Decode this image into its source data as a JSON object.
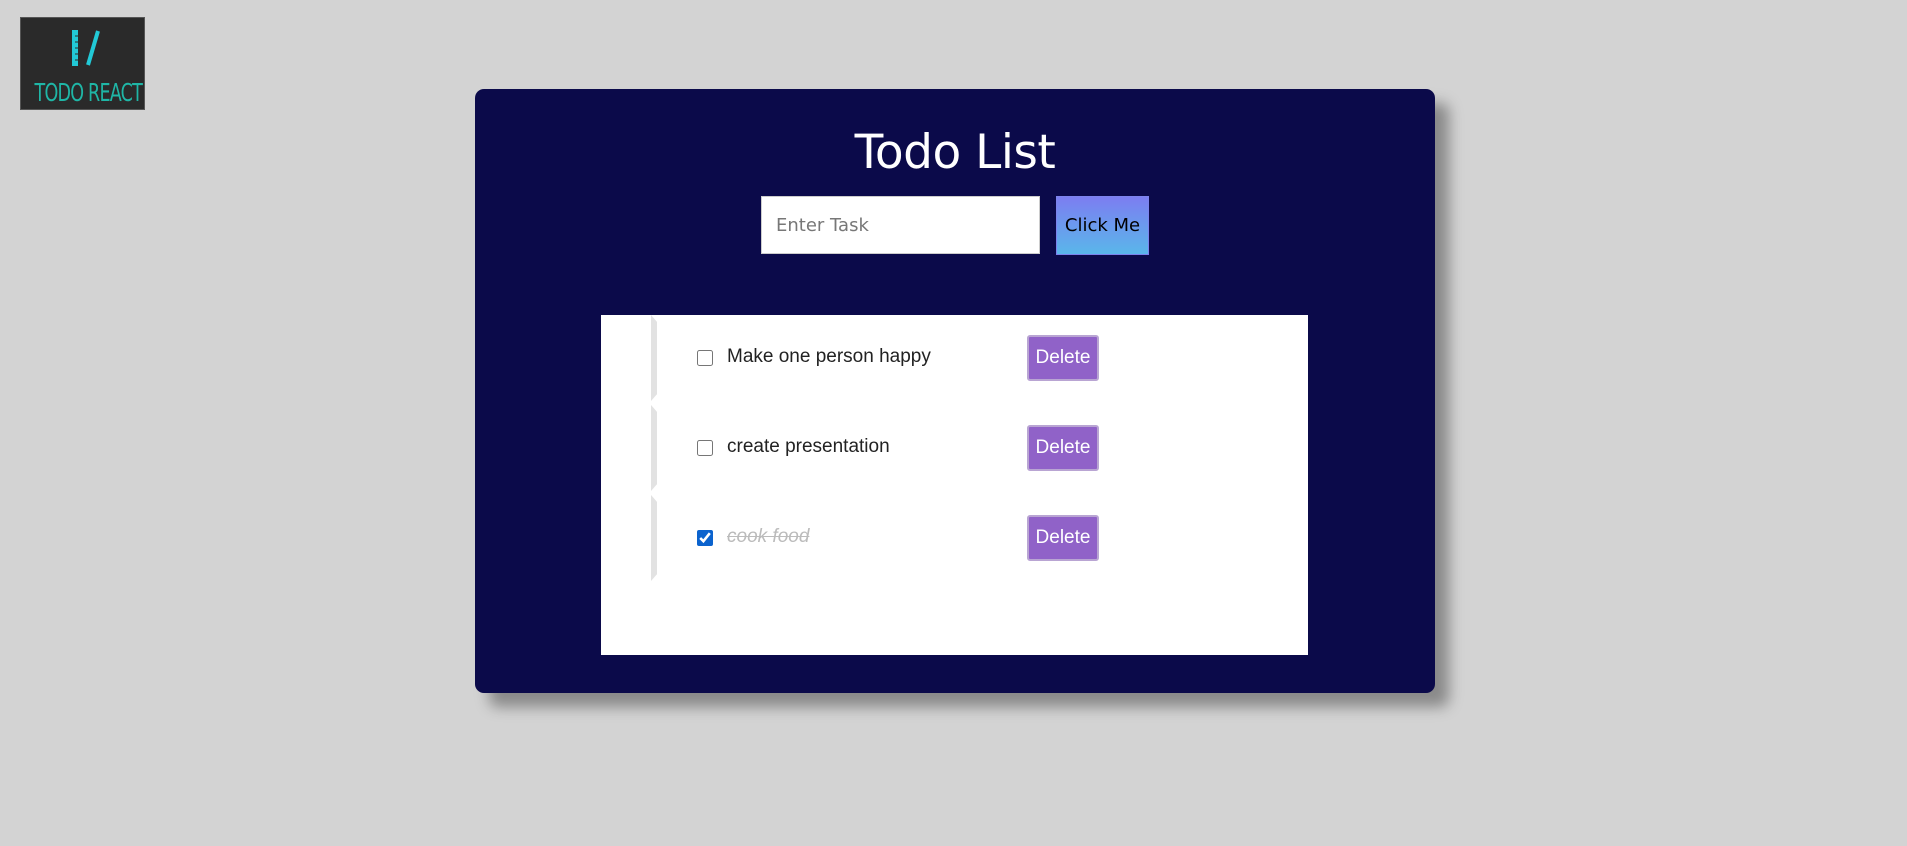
{
  "logo": {
    "text": "TODO REACT",
    "color": "#1fb6a6"
  },
  "card": {
    "title": "Todo List",
    "background": "#0b0a4a"
  },
  "input": {
    "placeholder": "Enter Task",
    "value": ""
  },
  "add_button": {
    "label": "Click Me"
  },
  "todos": [
    {
      "text": "Make one person happy",
      "completed": false,
      "delete_label": "Delete"
    },
    {
      "text": "create presentation",
      "completed": false,
      "delete_label": "Delete"
    },
    {
      "text": "cook food",
      "completed": true,
      "delete_label": "Delete"
    }
  ],
  "colors": {
    "page_background": "#d3d3d3",
    "delete_button": "#9062c8",
    "add_button_gradient": [
      "#7c7df1",
      "#5ab6ea"
    ]
  }
}
